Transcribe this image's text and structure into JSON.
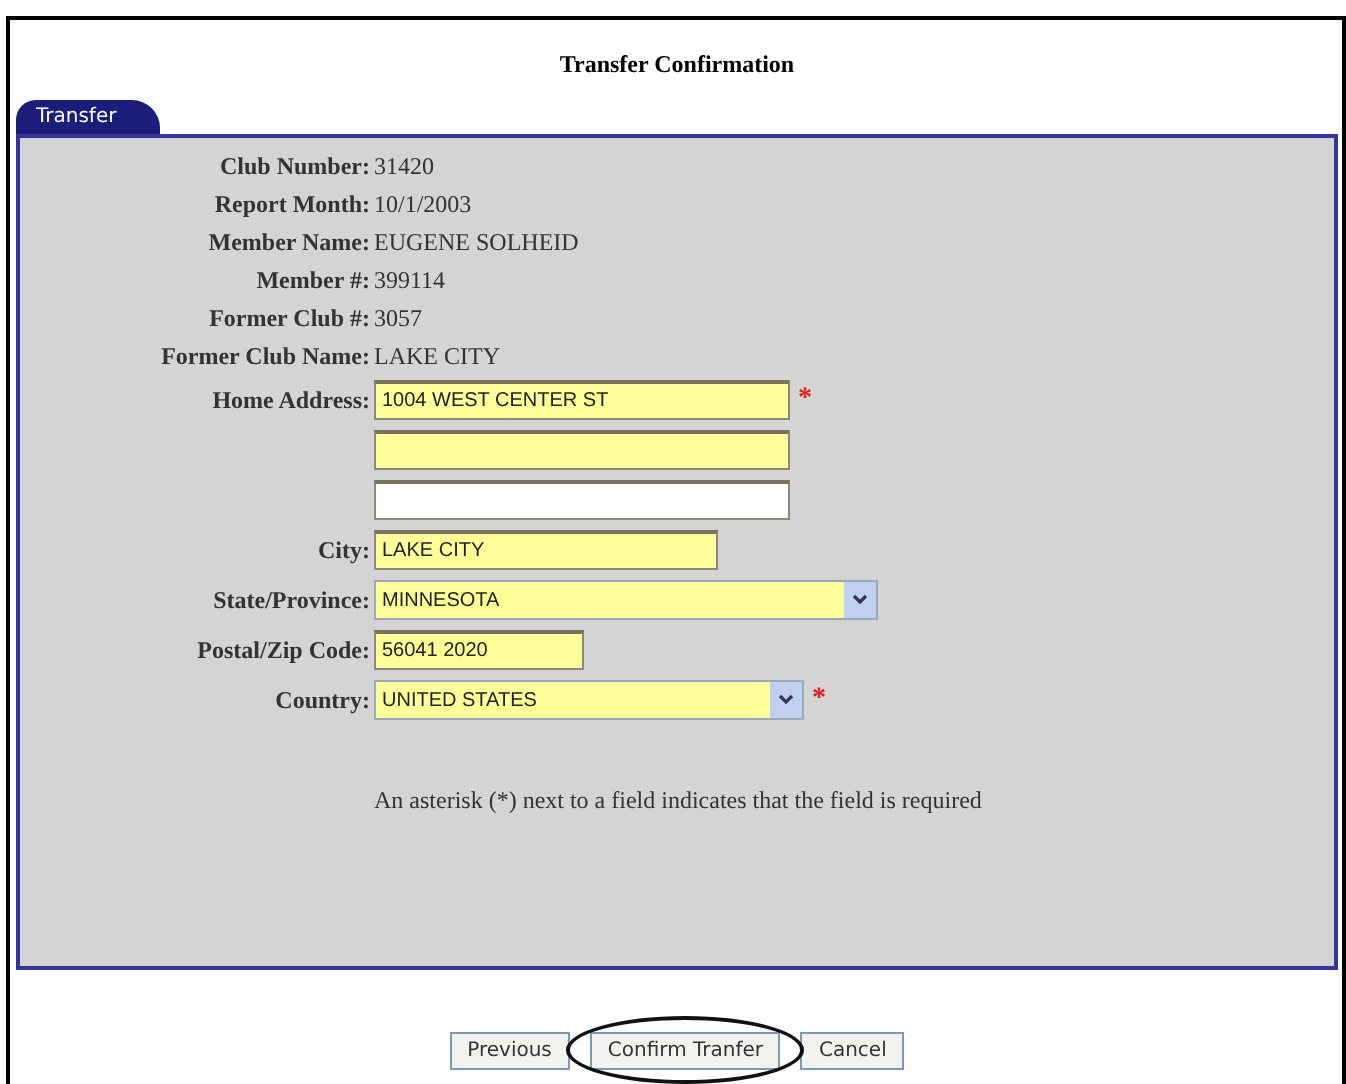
{
  "title": "Transfer Confirmation",
  "tab": {
    "label": "Transfer",
    "selected": true
  },
  "info": [
    {
      "label": "Club Number:",
      "value": "31420"
    },
    {
      "label": "Report Month:",
      "value": "10/1/2003"
    },
    {
      "label": "Member Name:",
      "value": "EUGENE SOLHEID"
    },
    {
      "label": "Member #:",
      "value": "399114"
    },
    {
      "label": "Former Club #:",
      "value": "3057"
    },
    {
      "label": "Former Club Name:",
      "value": "LAKE CITY"
    }
  ],
  "fields": [
    {
      "label": "Home Address:",
      "kind": "text",
      "value": "1004 WEST CENTER ST",
      "highlighted": true,
      "required": true
    },
    {
      "kind": "text",
      "highlighted": true,
      "required": false
    },
    {
      "kind": "text",
      "highlighted": false,
      "required": false
    },
    {
      "label": "City:",
      "kind": "text",
      "value": "LAKE CITY",
      "highlighted": true,
      "required": false
    },
    {
      "label": "State/Province:",
      "kind": "select",
      "value": "MINNESOTA",
      "highlighted": true,
      "required": false
    },
    {
      "label": "Postal/Zip Code:",
      "kind": "text",
      "value": "56041 2020",
      "highlighted": true,
      "required": false
    },
    {
      "label": "Country:",
      "kind": "select",
      "value": "UNITED STATES",
      "highlighted": true,
      "required": true
    }
  ],
  "note": "An asterisk (*) next to a field indicates that the field is required",
  "required_mark": "*",
  "buttons": [
    {
      "label": "Previous",
      "circled": false
    },
    {
      "label": "Confirm Tranfer",
      "circled": true
    },
    {
      "label": "Cancel",
      "circled": false
    }
  ]
}
